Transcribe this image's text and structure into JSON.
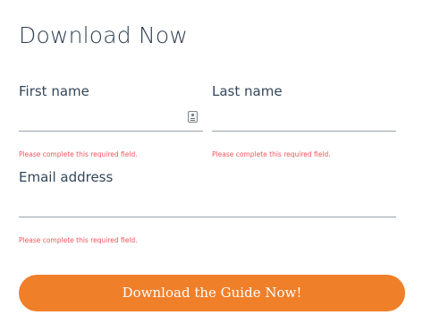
{
  "form": {
    "title": "Download Now",
    "fields": {
      "first_name": {
        "label": "First name",
        "value": "",
        "placeholder": "",
        "error": "Please complete this required field."
      },
      "last_name": {
        "label": "Last name",
        "value": "",
        "placeholder": "",
        "error": "Please complete this required field."
      },
      "email": {
        "label": "Email address",
        "value": "",
        "placeholder": "",
        "error": "Please complete this required field."
      }
    },
    "submit_label": "Download the Guide Now!",
    "icons": {
      "autofill": "contact-card-autofill-icon"
    }
  },
  "colors": {
    "accent": "#f07f2a",
    "error": "#f2545b",
    "text": "#33475b",
    "border": "#9aa4ae"
  }
}
